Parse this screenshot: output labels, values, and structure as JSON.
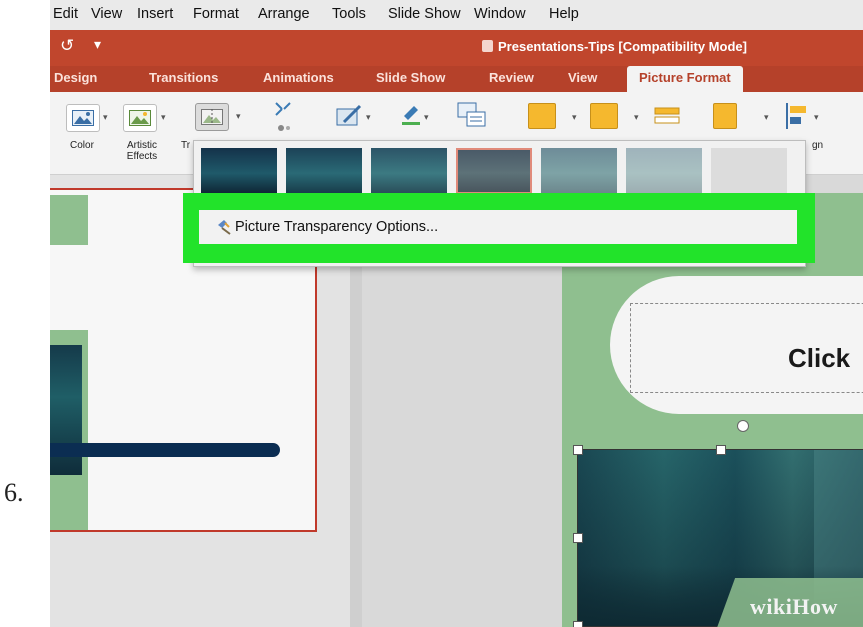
{
  "step_number": "6.",
  "menubar": [
    "Edit",
    "View",
    "Insert",
    "Format",
    "Arrange",
    "Tools",
    "Slide Show",
    "Window",
    "Help"
  ],
  "titlebar": {
    "undo": "↺",
    "quick_access": "▾",
    "document_title": "Presentations-Tips [Compatibility Mode]"
  },
  "tabs": [
    "Design",
    "Transitions",
    "Animations",
    "Slide Show",
    "Review",
    "View",
    "Picture Format"
  ],
  "active_tab": "Picture Format",
  "ribbon": {
    "color_label": "Color",
    "artistic_effects_label": "Artistic Effects",
    "transparency_label_partial": "Tr",
    "align_label_partial": "gn"
  },
  "dropdown": {
    "preset_count": 7,
    "selected_preset_index": 3,
    "option_label": "Picture Transparency Options..."
  },
  "slide": {
    "title_partial": "Click"
  },
  "watermark": "wikiHow",
  "colors": {
    "accent": "#c0462d",
    "ribbon_tab_bar": "#b5412a",
    "highlight": "#22e32a",
    "slide_green": "#8fbf8f"
  }
}
